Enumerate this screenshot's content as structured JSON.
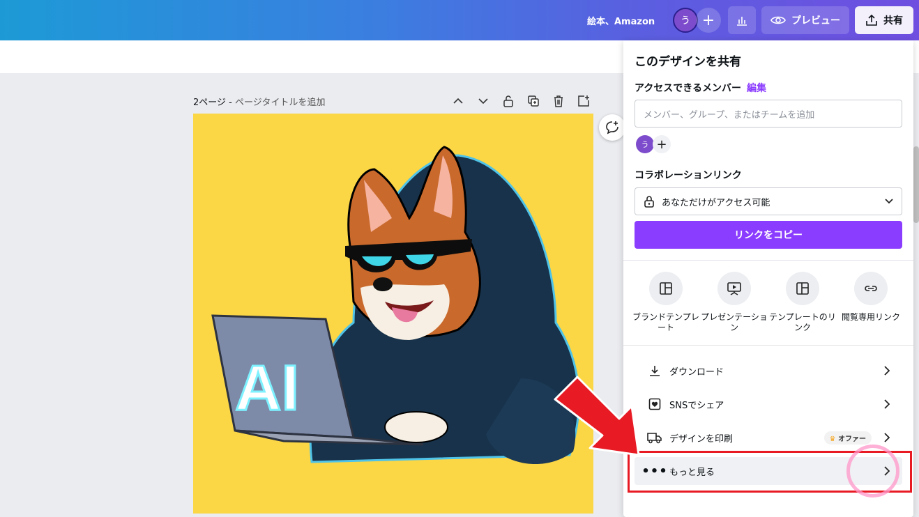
{
  "topbar": {
    "doc_title": "絵本、Amazon",
    "avatar_initial": "う",
    "preview_label": "プレビュー",
    "share_label": "共有"
  },
  "page": {
    "number_label": "2ページ - ",
    "title_placeholder": "ページタイトルを追加",
    "canvas_text": "AI"
  },
  "share_panel": {
    "title": "このデザインを共有",
    "members_label": "アクセスできるメンバー",
    "edit_label": "編集",
    "member_input_placeholder": "メンバー、グループ、またはチームを追加",
    "member_initial": "う",
    "collab_label": "コラボレーションリンク",
    "access_value": "あなただけがアクセス可能",
    "copy_link_label": "リンクをコピー",
    "options": [
      {
        "label": "ブランドテンプレート",
        "icon": "template-icon"
      },
      {
        "label": "プレゼンテーション",
        "icon": "presentation-icon"
      },
      {
        "label": "テンプレートのリンク",
        "icon": "template-link-icon"
      },
      {
        "label": "閲覧専用リンク",
        "icon": "link-icon"
      }
    ],
    "rows": [
      {
        "label": "ダウンロード",
        "icon": "download-icon"
      },
      {
        "label": "SNSでシェア",
        "icon": "heart-icon"
      },
      {
        "label": "デザインを印刷",
        "icon": "truck-icon",
        "badge": "オファー"
      },
      {
        "label": "もっと見る",
        "icon": "more-icon"
      }
    ]
  },
  "colors": {
    "accent": "#8b3dff",
    "canvas_bg": "#fbd645",
    "highlight_red": "#e81a24"
  }
}
